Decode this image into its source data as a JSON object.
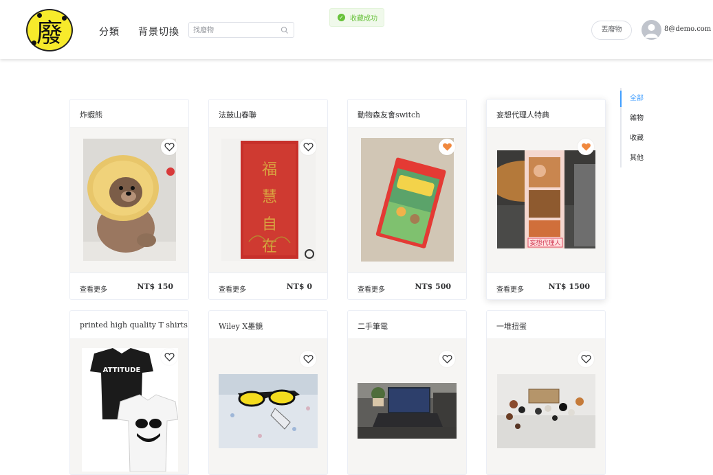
{
  "header": {
    "logo_char": "廢",
    "nav": [
      "分類",
      "背景切換"
    ],
    "search_placeholder": "找廢物",
    "toast": "收藏成功",
    "throw_button": "丟廢物",
    "user_email": "8@demo.com"
  },
  "categories": [
    {
      "label": "全部",
      "active": true
    },
    {
      "label": "雜物",
      "active": false
    },
    {
      "label": "收藏",
      "active": false
    },
    {
      "label": "其他",
      "active": false
    }
  ],
  "cards": [
    {
      "title": "炸蝦熊",
      "more": "查看更多",
      "price": "NT$ 150",
      "favorited": false,
      "photo": "plush-bear"
    },
    {
      "title": "法鼓山春聯",
      "more": "查看更多",
      "price": "NT$ 0",
      "favorited": false,
      "photo": "red-couplet"
    },
    {
      "title": "動物森友會switch",
      "more": "查看更多",
      "price": "NT$ 500",
      "favorited": true,
      "photo": "switch-game"
    },
    {
      "title": "妄想代理人特典",
      "more": "查看更多",
      "price": "NT$ 1500",
      "favorited": true,
      "photo": "anime-bookmark"
    },
    {
      "title": "printed high quality T shirts",
      "favorited": false,
      "photo": "tshirts"
    },
    {
      "title": "Wiley X墨鏡",
      "favorited": false,
      "photo": "sunglasses"
    },
    {
      "title": "二手筆電",
      "favorited": false,
      "photo": "laptop"
    },
    {
      "title": "一堆扭蛋",
      "favorited": false,
      "photo": "gashapon-figures"
    }
  ],
  "photo_text": {
    "tshirt_text": "ATTITUDE",
    "bookmark_label": "妄想代理人",
    "couplet_text": "福慧自在"
  },
  "colors": {
    "accent": "#409eff",
    "favorite": "#f0883e",
    "success": "#67c23a"
  }
}
